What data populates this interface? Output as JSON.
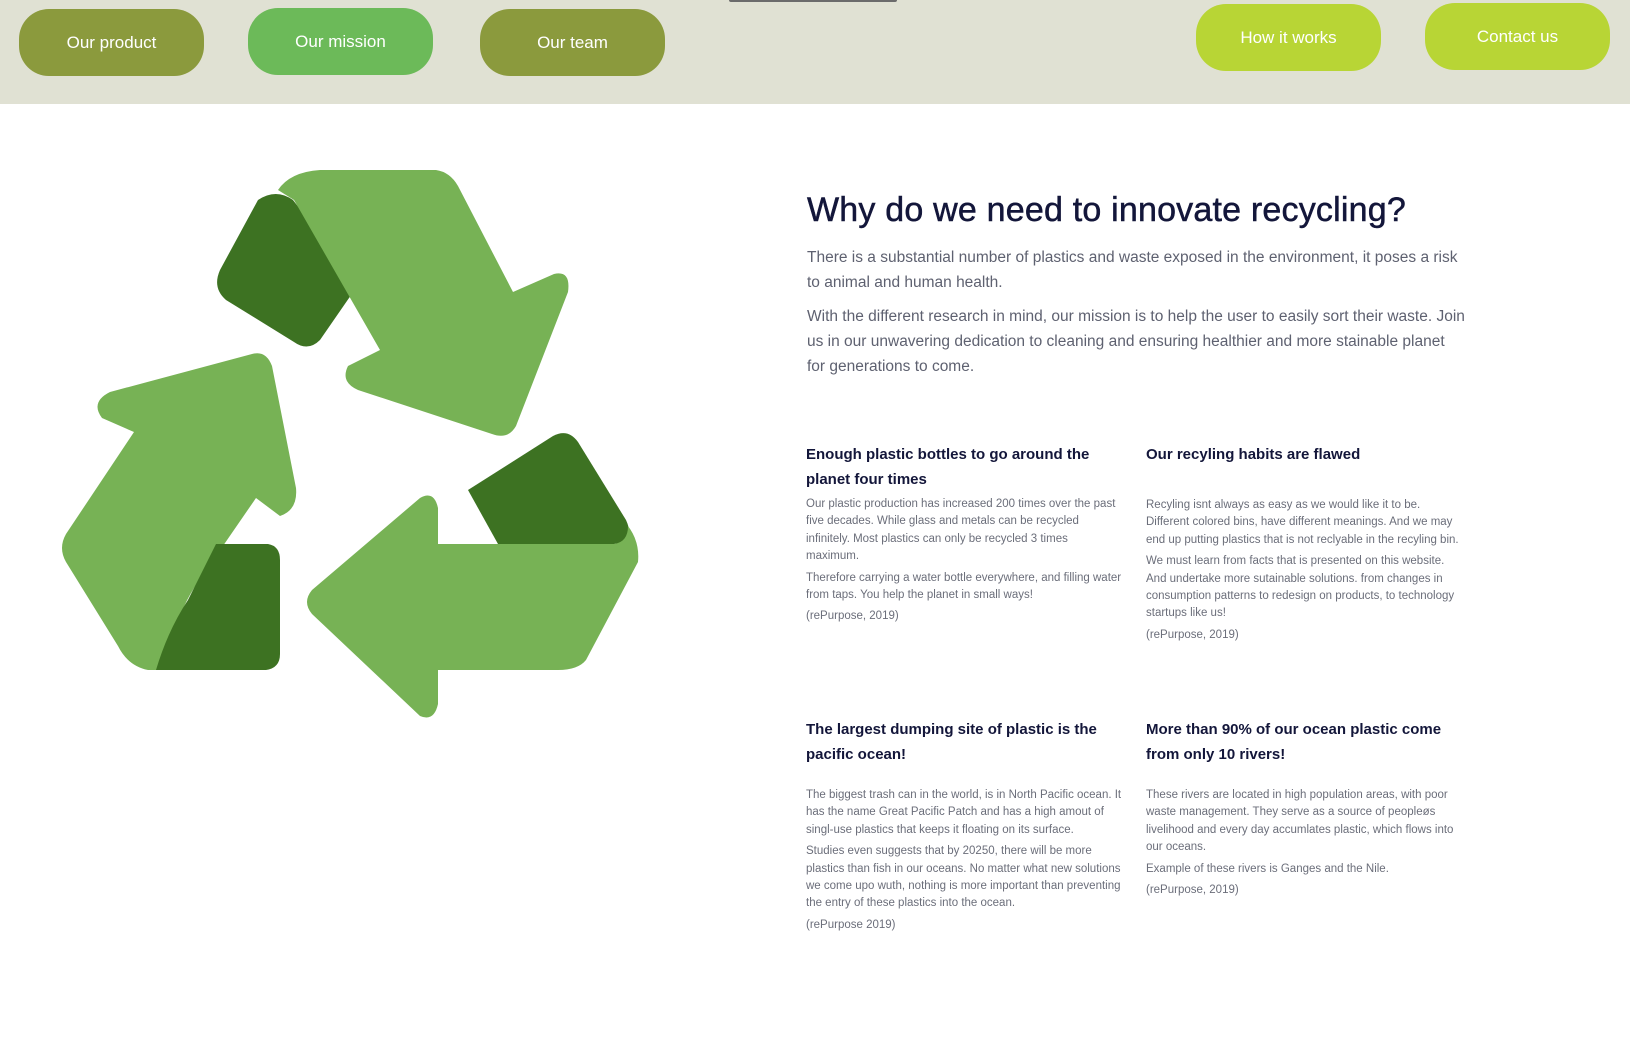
{
  "nav": {
    "our_product": "Our product",
    "our_mission": "Our mission",
    "our_team": "Our team",
    "how_it_works": "How it works",
    "contact_us": "Contact us"
  },
  "colors": {
    "topbar_bg": "#e0e1d3",
    "olive": "#8b9a3d",
    "green": "#6cba59",
    "lime": "#b8d535",
    "recycle_light": "#77b255",
    "recycle_dark": "#3d7222",
    "heading": "#13163a"
  },
  "logo": {
    "icon": "recycle-icon"
  },
  "main": {
    "headline": "Why do we need to innovate recycling?",
    "intro": [
      "There is a substantial number of plastics and waste exposed in the environment, it poses a risk to animal and human health.",
      "With the different research in mind, our mission is to help the user to easily sort their waste. Join us in our unwavering dedication to cleaning and ensuring healthier and more stainable planet for generations to come."
    ]
  },
  "facts": [
    {
      "title": "Enough plastic bottles to go around the planet four times",
      "paragraphs": [
        "Our plastic production has increased 200 times over the past five decades. While glass and metals can be recycled infinitely. Most plastics can only be recycled 3 times maximum.",
        "Therefore carrying a water bottle everywhere, and filling water from taps. You help the planet in small ways!",
        "(rePurpose, 2019)"
      ]
    },
    {
      "title": "Our recyling habits are flawed",
      "paragraphs": [
        "Recyling isnt always as easy as we would like it to be. Different colored bins, have different meanings. And we may end up putting plastics that is not reclyable in the recyling bin.",
        "We must learn from facts that is presented on this website. And undertake more sutainable solutions. from changes in consumption patterns to redesign on products, to technology startups like us!",
        "(rePurpose, 2019)"
      ]
    },
    {
      "title": "The largest dumping site of plastic is the pacific ocean!",
      "paragraphs": [
        "The biggest trash can in the world, is in North Pacific ocean. It has the name Great Pacific Patch and has a high amout of singl-use plastics that keeps it floating on its surface.",
        "Studies even suggests that by 20250, there will be more plastics than fish in our oceans. No matter what new solutions we come upo wuth, nothing is more important than preventing the entry of these plastics into the ocean.",
        "(rePurpose 2019)"
      ]
    },
    {
      "title": "More than 90% of our ocean plastic come from only 10 rivers!",
      "paragraphs": [
        "These rivers are located in high population areas, with poor waste management. They serve as a source of peopleøs livelihood and every day accumlates plastic, which flows into our oceans.",
        "Example of these rivers is Ganges and the Nile.",
        "(rePurpose, 2019)"
      ]
    }
  ]
}
